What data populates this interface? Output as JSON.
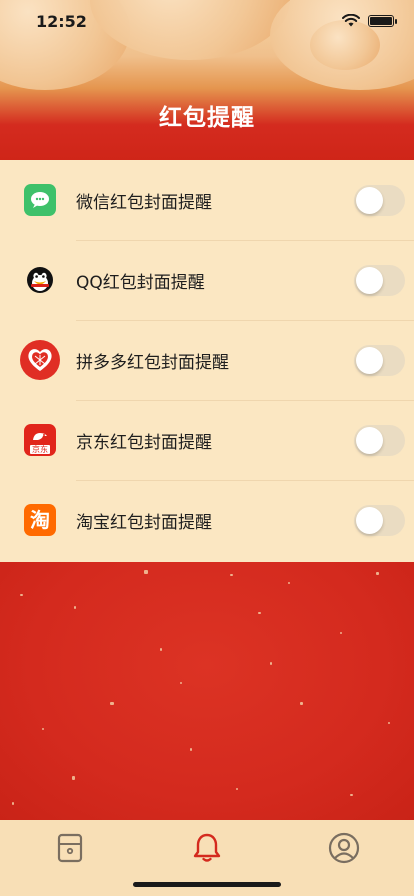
{
  "status_bar": {
    "time": "12:52"
  },
  "page": {
    "title": "红包提醒"
  },
  "reminders": [
    {
      "label": "微信红包封面提醒",
      "icon": "wechat-icon",
      "enabled": false
    },
    {
      "label": "QQ红包封面提醒",
      "icon": "qq-penguin-icon",
      "enabled": false
    },
    {
      "label": "拼多多红包封面提醒",
      "icon": "pinduoduo-icon",
      "enabled": false
    },
    {
      "label": "京东红包封面提醒",
      "icon": "jd-icon",
      "enabled": false,
      "icon_text": "京东"
    },
    {
      "label": "淘宝红包封面提醒",
      "icon": "taobao-icon",
      "enabled": false,
      "icon_text": "淘"
    }
  ],
  "tabbar": {
    "items": [
      {
        "icon": "card-icon",
        "active": false
      },
      {
        "icon": "bell-icon",
        "active": true
      },
      {
        "icon": "user-icon",
        "active": false
      }
    ],
    "active_color": "#d42a1e",
    "inactive_color": "#7a6e60"
  },
  "colors": {
    "brand_red": "#d62b20",
    "list_bg": "#fbe7c2",
    "toggle_off": "#eadcc2"
  }
}
